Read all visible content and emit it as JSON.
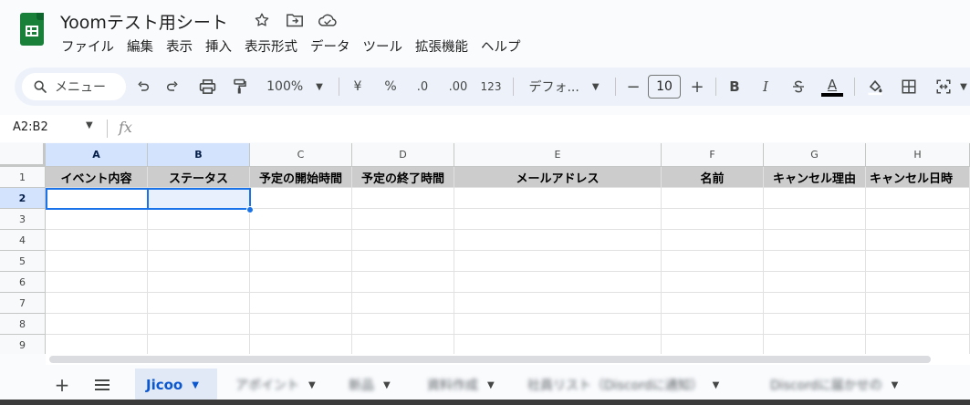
{
  "doc": {
    "title": "Yoomテスト用シート"
  },
  "menu": [
    "ファイル",
    "編集",
    "表示",
    "挿入",
    "表示形式",
    "データ",
    "ツール",
    "拡張機能",
    "ヘルプ"
  ],
  "toolbar": {
    "search_label": "メニュー",
    "zoom": "100%",
    "currency": "¥",
    "percent": "%",
    "decrease_decimal": ".0",
    "increase_decimal": ".00",
    "number_format": "123",
    "font": "デフォ...",
    "font_size": "10",
    "bold": "B",
    "italic": "I",
    "text_color_label": "A"
  },
  "formula_bar": {
    "name_box": "A2:B2",
    "fx": "fx"
  },
  "grid": {
    "columns": [
      "A",
      "B",
      "C",
      "D",
      "E",
      "F",
      "G",
      "H"
    ],
    "rows": [
      "1",
      "2",
      "3",
      "4",
      "5",
      "6",
      "7",
      "8",
      "9"
    ],
    "header_row": [
      "イベント内容",
      "ステータス",
      "予定の開始時間",
      "予定の終了時間",
      "メールアドレス",
      "名前",
      "キャンセル理由",
      "キャンセル日時"
    ],
    "header_fill": "#cccccc",
    "selection_color": "#1a73e8"
  },
  "sheets": {
    "active": "Jicoo",
    "others": [
      "アポイント",
      "新品",
      "資料作成",
      "社員リスト（Discordに通知）",
      "Discordに届かせの"
    ]
  }
}
